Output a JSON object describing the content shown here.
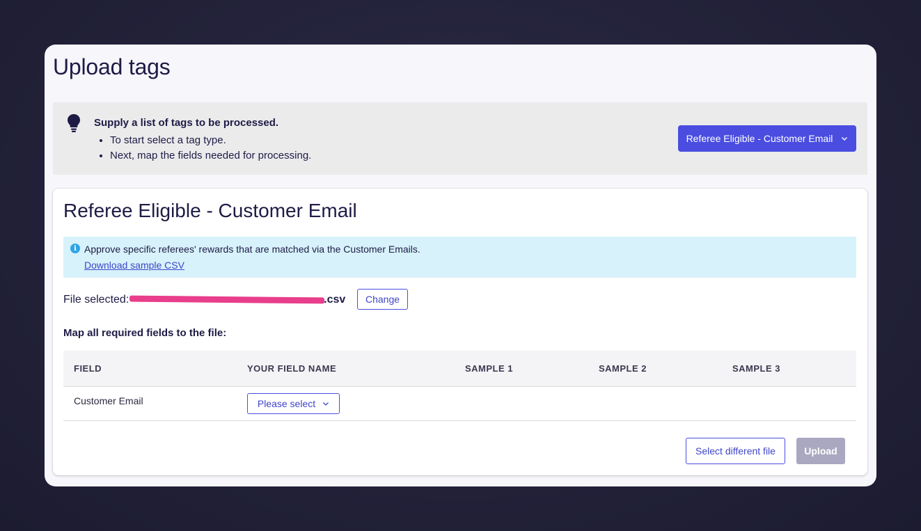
{
  "page": {
    "title": "Upload tags"
  },
  "info": {
    "heading": "Supply a list of tags to be processed.",
    "steps": [
      "To start select a tag type.",
      "Next, map the fields needed for processing."
    ],
    "tag_type_selected": "Referee Eligible - Customer Email"
  },
  "card": {
    "title": "Referee Eligible - Customer Email",
    "alert": {
      "text": "Approve specific referees' rewards that are matched via the Customer Emails.",
      "link": "Download sample CSV"
    },
    "file": {
      "label": "File selected:",
      "name": "….csv",
      "change_label": "Change"
    },
    "map_heading": "Map all required fields to the file:",
    "table": {
      "headers": [
        "FIELD",
        "YOUR FIELD NAME",
        "SAMPLE 1",
        "SAMPLE 2",
        "SAMPLE 3"
      ],
      "rows": [
        {
          "field": "Customer Email",
          "select_placeholder": "Please select",
          "sample1": "",
          "sample2": "",
          "sample3": ""
        }
      ]
    },
    "actions": {
      "select_different": "Select different file",
      "upload": "Upload"
    }
  },
  "colors": {
    "primary": "#4a4de0",
    "alert_bg": "#d7f2fb",
    "disabled": "#a9a8c0",
    "redaction": "#e83e8c"
  }
}
